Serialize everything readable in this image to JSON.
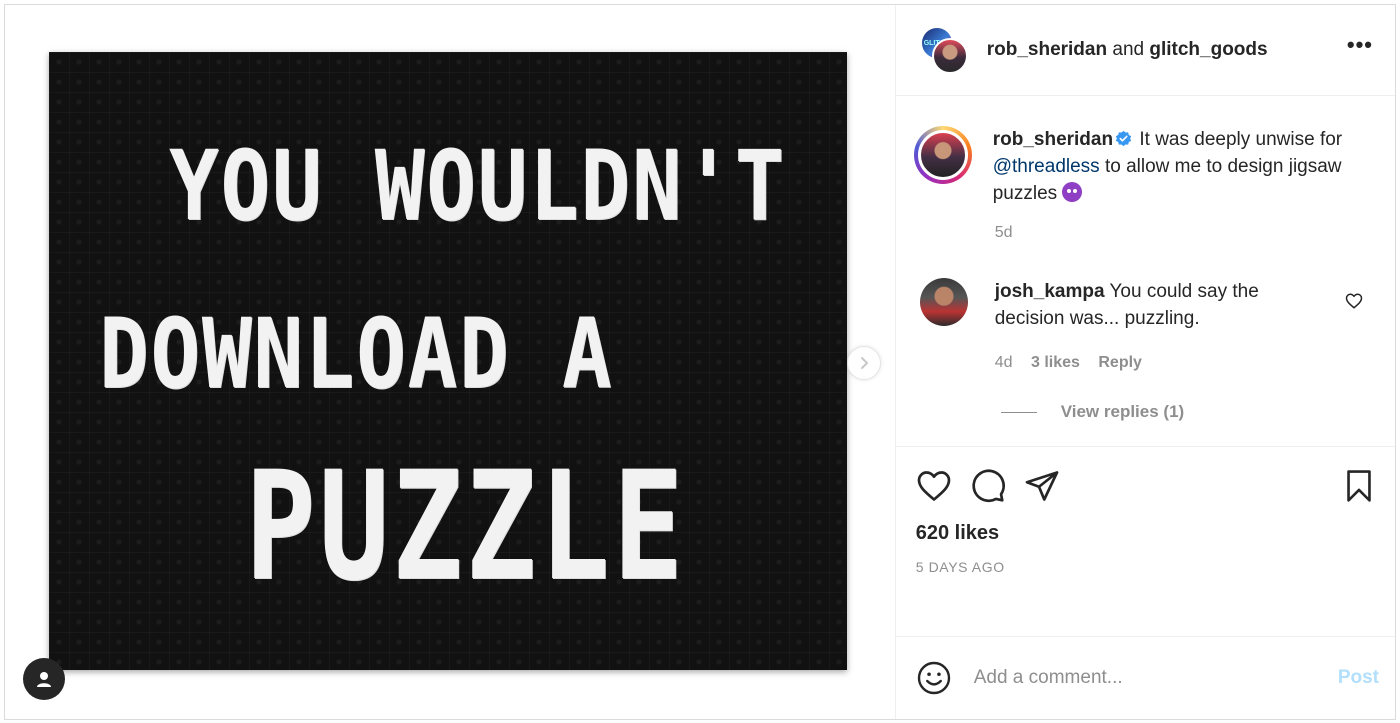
{
  "media": {
    "puzzle_lines": [
      "YOU WOULDN'T",
      "DOWNLOAD A",
      "PUZZLE"
    ],
    "next_icon": "chevron-right-icon",
    "tag_icon": "user-icon"
  },
  "header": {
    "user1": "rob_sheridan",
    "and": "and",
    "user2": "glitch_goods",
    "more_label": "•••",
    "avatar_text": "GLITCH"
  },
  "caption": {
    "username": "rob_sheridan",
    "text_a": " It was deeply unwise for ",
    "mention": "@threadless",
    "text_b": " to allow me to design jigsaw puzzles ",
    "time": "5d",
    "emoji": "smiling-imp-emoji"
  },
  "comment": {
    "username": "josh_kampa",
    "text": " You could say the decision was... puzzling.",
    "time": "4d",
    "likes": "3 likes",
    "reply_label": "Reply",
    "view_replies": "View replies (1)"
  },
  "actions": {
    "likes": "620 likes",
    "timestamp": "5 DAYS AGO"
  },
  "add_comment": {
    "placeholder": "Add a comment...",
    "post_label": "Post"
  },
  "colors": {
    "accent_link": "#00376b",
    "verified_blue": "#3897f0",
    "post_disabled": "#b2dffc"
  }
}
